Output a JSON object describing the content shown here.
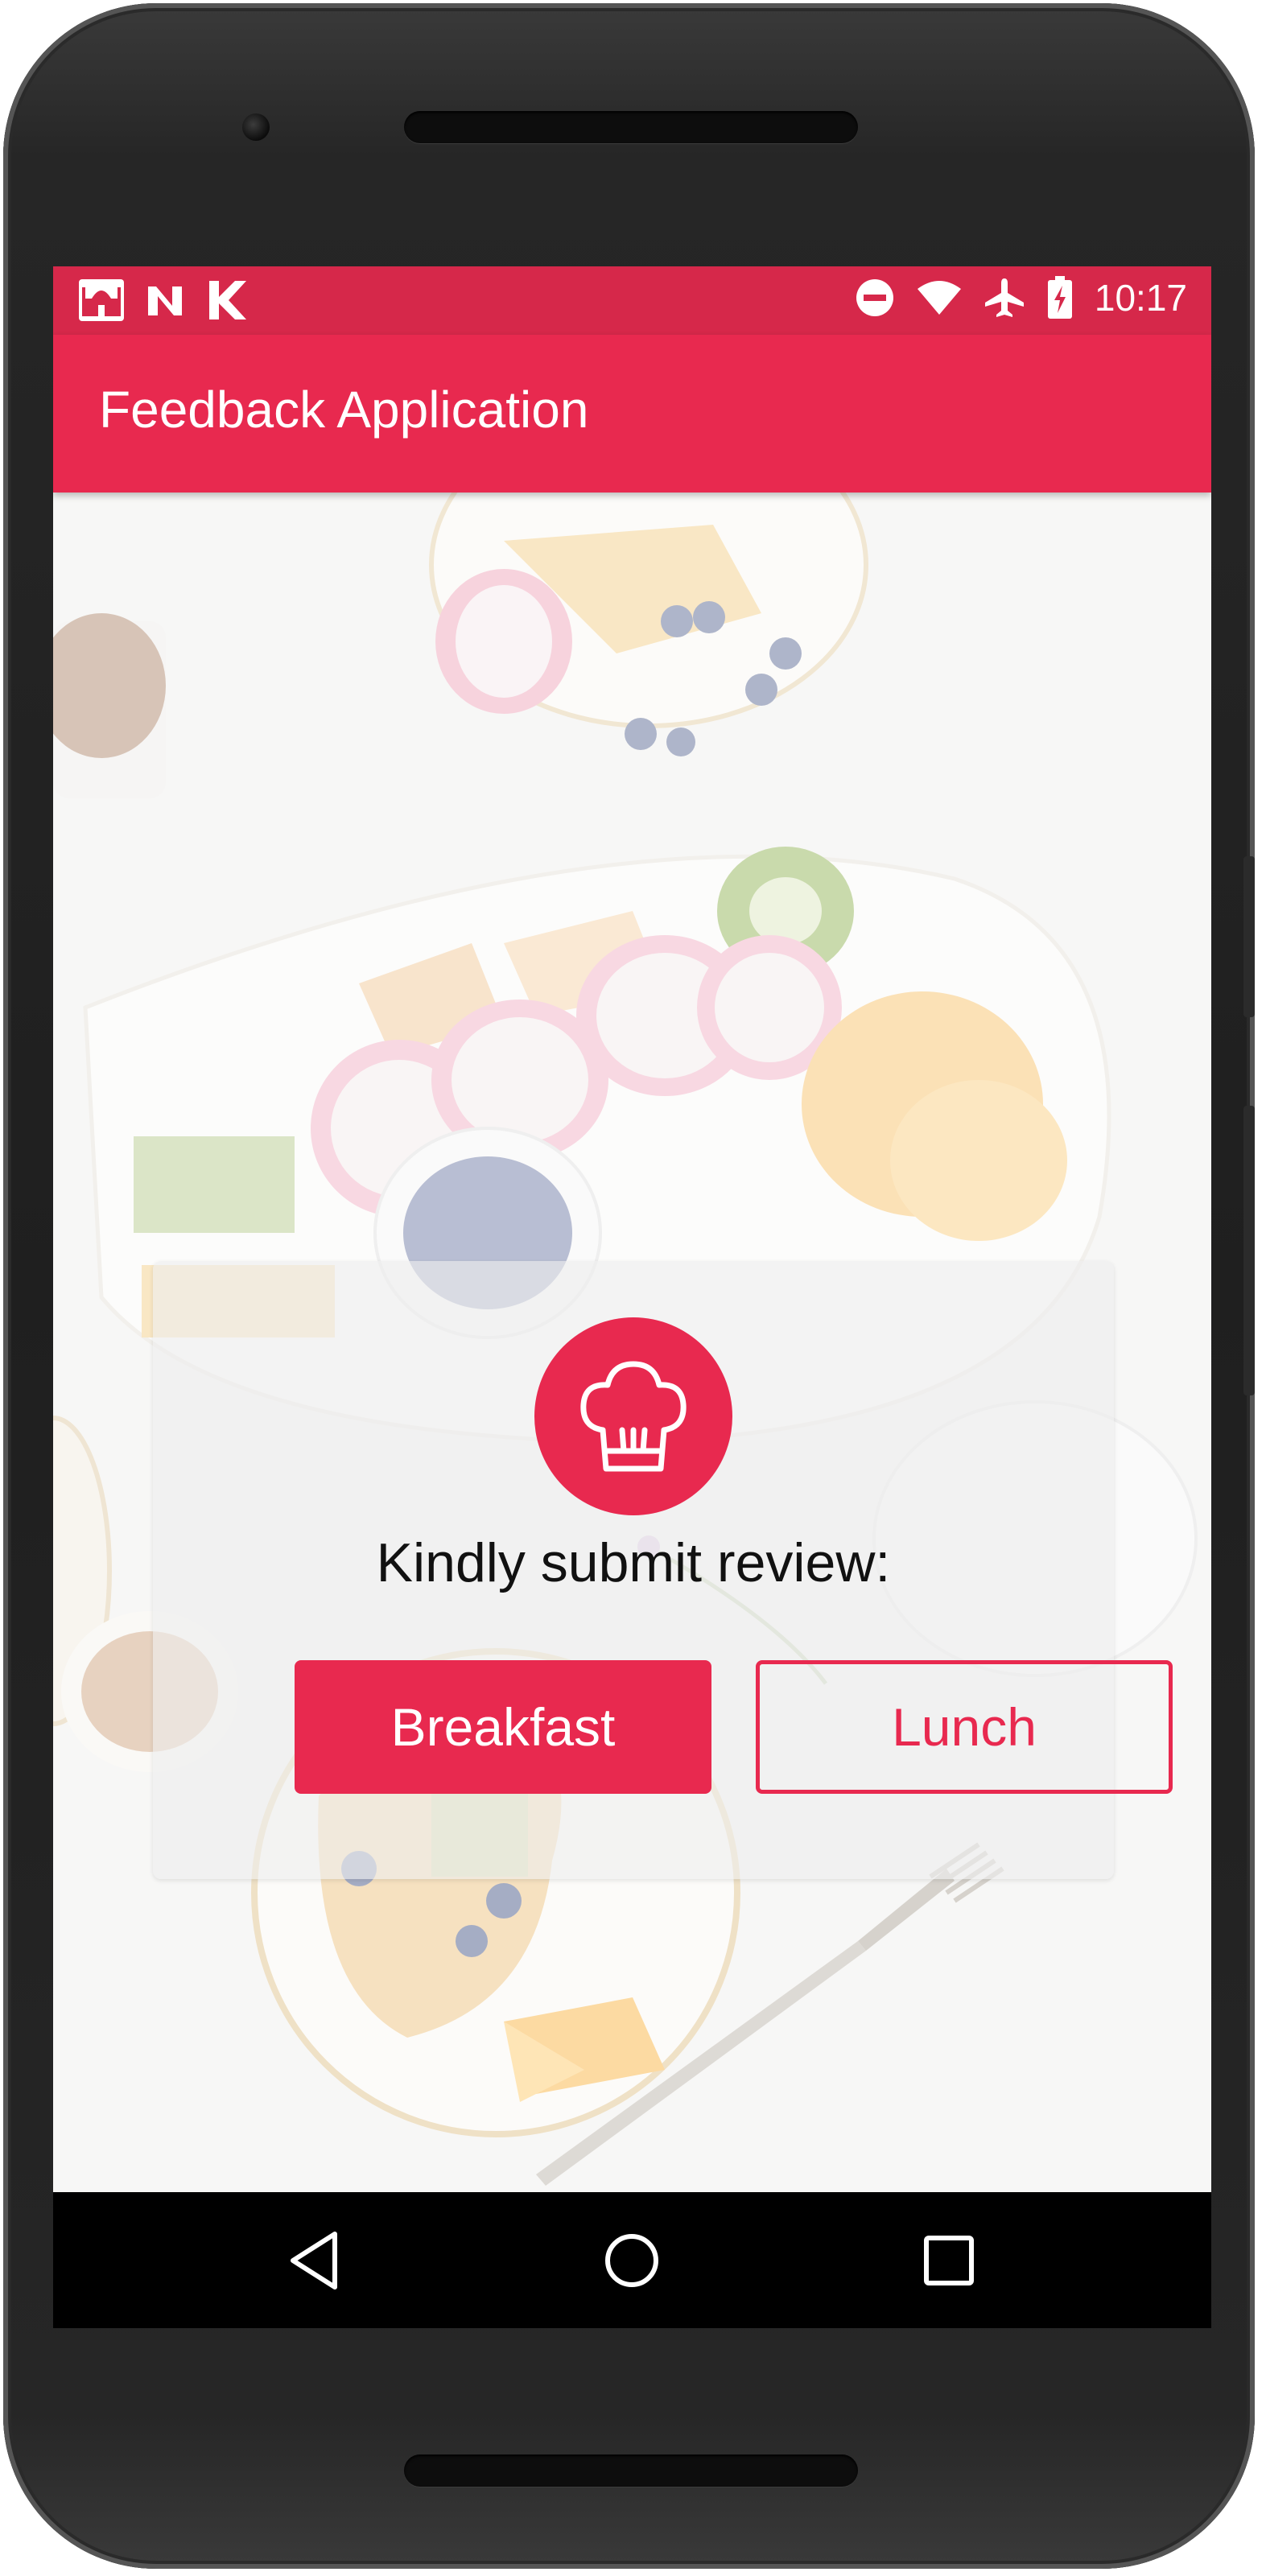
{
  "status_bar": {
    "time": "10:17",
    "left_icons": [
      "mosque-app-icon",
      "n-app-icon",
      "k-app-icon"
    ],
    "right_icons": [
      "do-not-disturb-icon",
      "wifi-icon",
      "airplane-icon",
      "battery-charging-icon"
    ]
  },
  "app_bar": {
    "title": "Feedback Application"
  },
  "card": {
    "icon": "chef-hat-icon",
    "prompt": "Kindly submit review:",
    "buttons": {
      "breakfast": "Breakfast",
      "lunch": "Lunch"
    }
  },
  "nav_bar": {
    "items": [
      "back-icon",
      "home-icon",
      "recents-icon"
    ]
  },
  "colors": {
    "primary": "#e8294f",
    "status_bar": "#d6284a",
    "nav_bar": "#000000"
  }
}
